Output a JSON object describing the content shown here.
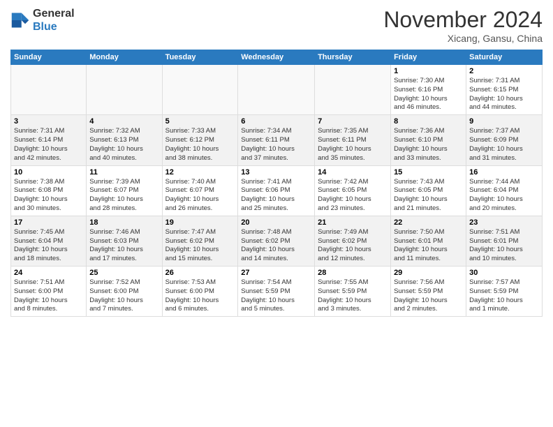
{
  "header": {
    "logo_line1": "General",
    "logo_line2": "Blue",
    "month_title": "November 2024",
    "location": "Xicang, Gansu, China"
  },
  "days_of_week": [
    "Sunday",
    "Monday",
    "Tuesday",
    "Wednesday",
    "Thursday",
    "Friday",
    "Saturday"
  ],
  "weeks": [
    [
      {
        "day": "",
        "info": ""
      },
      {
        "day": "",
        "info": ""
      },
      {
        "day": "",
        "info": ""
      },
      {
        "day": "",
        "info": ""
      },
      {
        "day": "",
        "info": ""
      },
      {
        "day": "1",
        "info": "Sunrise: 7:30 AM\nSunset: 6:16 PM\nDaylight: 10 hours\nand 46 minutes."
      },
      {
        "day": "2",
        "info": "Sunrise: 7:31 AM\nSunset: 6:15 PM\nDaylight: 10 hours\nand 44 minutes."
      }
    ],
    [
      {
        "day": "3",
        "info": "Sunrise: 7:31 AM\nSunset: 6:14 PM\nDaylight: 10 hours\nand 42 minutes."
      },
      {
        "day": "4",
        "info": "Sunrise: 7:32 AM\nSunset: 6:13 PM\nDaylight: 10 hours\nand 40 minutes."
      },
      {
        "day": "5",
        "info": "Sunrise: 7:33 AM\nSunset: 6:12 PM\nDaylight: 10 hours\nand 38 minutes."
      },
      {
        "day": "6",
        "info": "Sunrise: 7:34 AM\nSunset: 6:11 PM\nDaylight: 10 hours\nand 37 minutes."
      },
      {
        "day": "7",
        "info": "Sunrise: 7:35 AM\nSunset: 6:11 PM\nDaylight: 10 hours\nand 35 minutes."
      },
      {
        "day": "8",
        "info": "Sunrise: 7:36 AM\nSunset: 6:10 PM\nDaylight: 10 hours\nand 33 minutes."
      },
      {
        "day": "9",
        "info": "Sunrise: 7:37 AM\nSunset: 6:09 PM\nDaylight: 10 hours\nand 31 minutes."
      }
    ],
    [
      {
        "day": "10",
        "info": "Sunrise: 7:38 AM\nSunset: 6:08 PM\nDaylight: 10 hours\nand 30 minutes."
      },
      {
        "day": "11",
        "info": "Sunrise: 7:39 AM\nSunset: 6:07 PM\nDaylight: 10 hours\nand 28 minutes."
      },
      {
        "day": "12",
        "info": "Sunrise: 7:40 AM\nSunset: 6:07 PM\nDaylight: 10 hours\nand 26 minutes."
      },
      {
        "day": "13",
        "info": "Sunrise: 7:41 AM\nSunset: 6:06 PM\nDaylight: 10 hours\nand 25 minutes."
      },
      {
        "day": "14",
        "info": "Sunrise: 7:42 AM\nSunset: 6:05 PM\nDaylight: 10 hours\nand 23 minutes."
      },
      {
        "day": "15",
        "info": "Sunrise: 7:43 AM\nSunset: 6:05 PM\nDaylight: 10 hours\nand 21 minutes."
      },
      {
        "day": "16",
        "info": "Sunrise: 7:44 AM\nSunset: 6:04 PM\nDaylight: 10 hours\nand 20 minutes."
      }
    ],
    [
      {
        "day": "17",
        "info": "Sunrise: 7:45 AM\nSunset: 6:04 PM\nDaylight: 10 hours\nand 18 minutes."
      },
      {
        "day": "18",
        "info": "Sunrise: 7:46 AM\nSunset: 6:03 PM\nDaylight: 10 hours\nand 17 minutes."
      },
      {
        "day": "19",
        "info": "Sunrise: 7:47 AM\nSunset: 6:02 PM\nDaylight: 10 hours\nand 15 minutes."
      },
      {
        "day": "20",
        "info": "Sunrise: 7:48 AM\nSunset: 6:02 PM\nDaylight: 10 hours\nand 14 minutes."
      },
      {
        "day": "21",
        "info": "Sunrise: 7:49 AM\nSunset: 6:02 PM\nDaylight: 10 hours\nand 12 minutes."
      },
      {
        "day": "22",
        "info": "Sunrise: 7:50 AM\nSunset: 6:01 PM\nDaylight: 10 hours\nand 11 minutes."
      },
      {
        "day": "23",
        "info": "Sunrise: 7:51 AM\nSunset: 6:01 PM\nDaylight: 10 hours\nand 10 minutes."
      }
    ],
    [
      {
        "day": "24",
        "info": "Sunrise: 7:51 AM\nSunset: 6:00 PM\nDaylight: 10 hours\nand 8 minutes."
      },
      {
        "day": "25",
        "info": "Sunrise: 7:52 AM\nSunset: 6:00 PM\nDaylight: 10 hours\nand 7 minutes."
      },
      {
        "day": "26",
        "info": "Sunrise: 7:53 AM\nSunset: 6:00 PM\nDaylight: 10 hours\nand 6 minutes."
      },
      {
        "day": "27",
        "info": "Sunrise: 7:54 AM\nSunset: 5:59 PM\nDaylight: 10 hours\nand 5 minutes."
      },
      {
        "day": "28",
        "info": "Sunrise: 7:55 AM\nSunset: 5:59 PM\nDaylight: 10 hours\nand 3 minutes."
      },
      {
        "day": "29",
        "info": "Sunrise: 7:56 AM\nSunset: 5:59 PM\nDaylight: 10 hours\nand 2 minutes."
      },
      {
        "day": "30",
        "info": "Sunrise: 7:57 AM\nSunset: 5:59 PM\nDaylight: 10 hours\nand 1 minute."
      }
    ]
  ]
}
